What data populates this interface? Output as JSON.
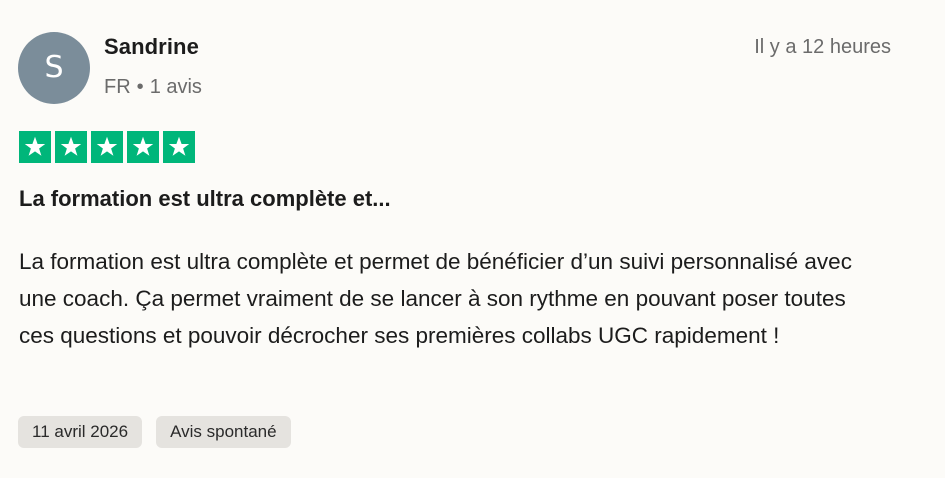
{
  "reviewer": {
    "avatar_initial": "S",
    "avatar_color": "#7b8d9a",
    "name": "Sandrine",
    "country": "FR",
    "separator": "•",
    "review_count": "1 avis"
  },
  "review": {
    "time_ago": "Il y a 12 heures",
    "rating": 5,
    "star_color": "#00b67a",
    "title": "La formation est ultra complète et...",
    "body": "La formation est ultra complète et permet de bénéficier d’un suivi personnalisé avec une coach. Ça permet vraiment de se lancer à son rythme en pouvant poser toutes ces questions et pouvoir décrocher ses premières collabs UGC rapidement !",
    "date_tag": "11 avril 2026",
    "source_tag": "Avis spontané"
  }
}
